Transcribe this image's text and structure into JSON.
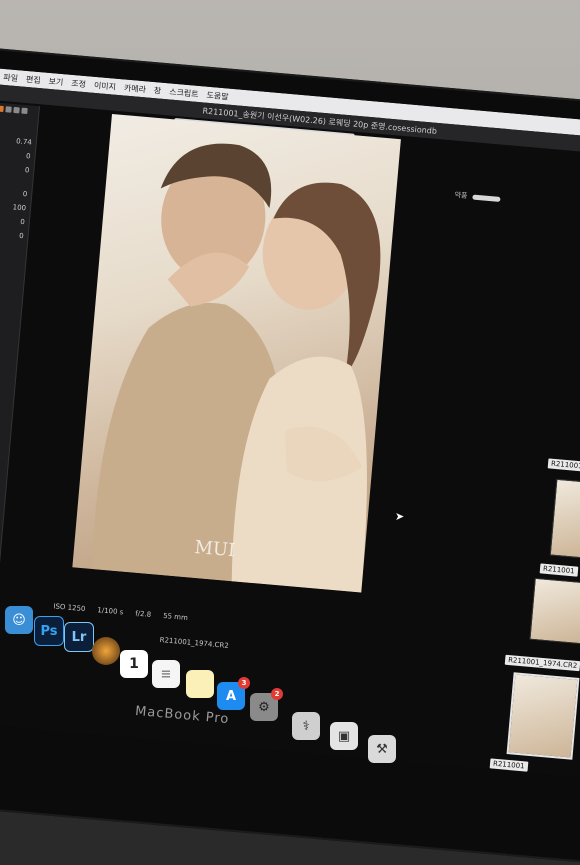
{
  "menubar": {
    "items": [
      "파일",
      "편집",
      "보기",
      "조정",
      "이미지",
      "카메라",
      "창",
      "스크립트",
      "도움말"
    ]
  },
  "window": {
    "title": "R211001_송원기 이선우(W02.26) 로웨딩 20p 준영.cosessiondb"
  },
  "toolbar": {
    "tools": [
      "cursor-tool",
      "pan-tool",
      "zoom-tool",
      "crop-tool",
      "rotate-tool",
      "keystone-tool",
      "mask-tool",
      "circle-tool",
      "brush-tool",
      "erase-tool",
      "picker-tool"
    ]
  },
  "left_panel": {
    "values": [
      "0.74",
      "0",
      "0",
      "0",
      "100",
      "0",
      "0"
    ]
  },
  "viewer": {
    "info": {
      "iso": "ISO 1250",
      "shutter": "1/100 s",
      "aperture": "f/2.8",
      "focal": "55 mm"
    },
    "filename": "R211001_1974.CR2",
    "watermark": "MUI"
  },
  "right_panel": {
    "header": "약품",
    "thumbnails": [
      {
        "label": "R211001"
      },
      {
        "label": "R211001"
      },
      {
        "label": "R211001_1974.CR2"
      },
      {
        "label": "R211001"
      }
    ]
  },
  "dock": {
    "calendar_day": "1",
    "appstore_badge": "3",
    "settings_badge": "2",
    "ps_label": "Ps",
    "lr_label": "Lr"
  },
  "brand": "MacBook Pro"
}
